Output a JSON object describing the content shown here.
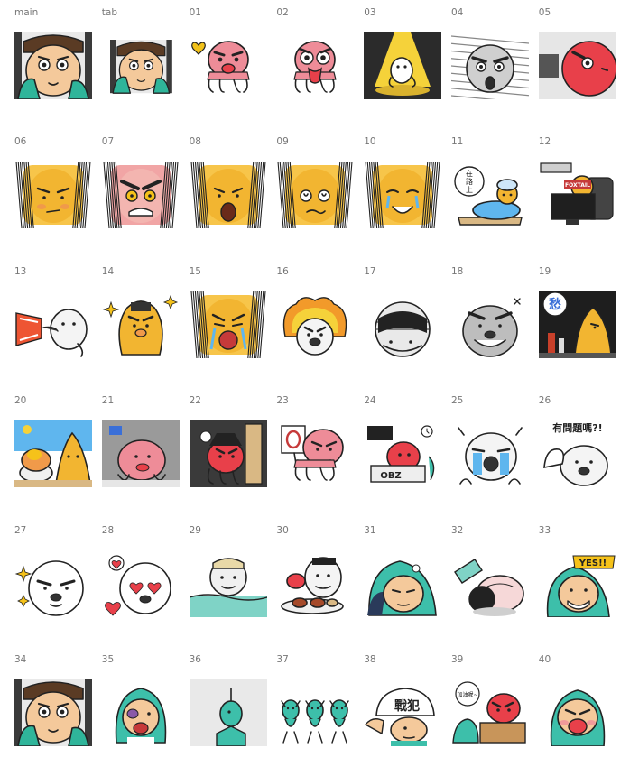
{
  "palette": {
    "outline": "#222222",
    "skin": "#f4c99b",
    "hair": "#5a3b24",
    "glove": "#2fb59a",
    "octopus": "#ee8c98",
    "octopus_red": "#e8404a",
    "yellow_bg": "#f7c54a",
    "yellow_face": "#f2b531",
    "seal": "#f4f4f4",
    "grey": "#8d8d8d",
    "teal": "#3dbfaa",
    "navy": "#2a3a5a",
    "sky": "#5fb6ee",
    "dark": "#2b2b2b",
    "water": "#7fd3c6"
  },
  "stickers": [
    {
      "label": "main",
      "icon": "surgeon-face-icon"
    },
    {
      "label": "tab",
      "icon": "surgeon-face-small-icon"
    },
    {
      "label": "01",
      "icon": "octopus-heart-icon"
    },
    {
      "label": "02",
      "icon": "octopus-tongue-icon"
    },
    {
      "label": "03",
      "icon": "spotlight-dancer-icon"
    },
    {
      "label": "04",
      "icon": "shocked-grey-face-icon"
    },
    {
      "label": "05",
      "icon": "red-ball-squash-icon"
    },
    {
      "label": "06",
      "icon": "yellow-face-annoyed-icon"
    },
    {
      "label": "07",
      "icon": "red-face-angry-icon"
    },
    {
      "label": "08",
      "icon": "yellow-face-shout-icon"
    },
    {
      "label": "09",
      "icon": "yellow-face-dizzy-icon"
    },
    {
      "label": "10",
      "icon": "yellow-face-tears-icon"
    },
    {
      "label": "11",
      "icon": "on-the-way-bed-icon",
      "bubble": [
        "在",
        "路",
        "上"
      ]
    },
    {
      "label": "12",
      "icon": "tv-watching-icon",
      "caption": "FOXTAIL"
    },
    {
      "label": "13",
      "icon": "megaphone-seal-icon"
    },
    {
      "label": "14",
      "icon": "yellow-sparkle-icon"
    },
    {
      "label": "15",
      "icon": "yellow-face-crying-icon"
    },
    {
      "label": "16",
      "icon": "seal-flame-icon"
    },
    {
      "label": "17",
      "icon": "bandaged-seal-icon"
    },
    {
      "label": "18",
      "icon": "grey-seal-grin-icon"
    },
    {
      "label": "19",
      "icon": "sorrow-drink-icon",
      "caption": "愁"
    },
    {
      "label": "20",
      "icon": "shaved-ice-icon"
    },
    {
      "label": "21",
      "icon": "pink-octopus-desk-icon"
    },
    {
      "label": "22",
      "icon": "pirate-octopus-icon"
    },
    {
      "label": "23",
      "icon": "octopus-sign-icon"
    },
    {
      "label": "24",
      "icon": "octopus-office-icon",
      "caption": "OBZ"
    },
    {
      "label": "25",
      "icon": "crying-seal-icon"
    },
    {
      "label": "26",
      "icon": "seal-question-icon",
      "caption": "有問題嗎?!"
    },
    {
      "label": "27",
      "icon": "seal-sparkle-icon"
    },
    {
      "label": "28",
      "icon": "seal-heart-eyes-icon"
    },
    {
      "label": "29",
      "icon": "seal-bath-icon"
    },
    {
      "label": "30",
      "icon": "seal-feast-icon"
    },
    {
      "label": "31",
      "icon": "teal-hood-sleep-icon"
    },
    {
      "label": "32",
      "icon": "teal-hood-fall-icon"
    },
    {
      "label": "33",
      "icon": "teal-hood-yes-icon",
      "caption": "YES!!"
    },
    {
      "label": "34",
      "icon": "surgeon-face-icon"
    },
    {
      "label": "35",
      "icon": "teal-hood-bruised-icon"
    },
    {
      "label": "36",
      "icon": "teal-figure-icon"
    },
    {
      "label": "37",
      "icon": "teal-figures-dance-icon"
    },
    {
      "label": "38",
      "icon": "cap-man-icon",
      "caption": "戰犯"
    },
    {
      "label": "39",
      "icon": "octopus-box-icon",
      "bubble": [
        "加油喔~"
      ]
    },
    {
      "label": "40",
      "icon": "teal-hood-kiss-icon"
    }
  ]
}
